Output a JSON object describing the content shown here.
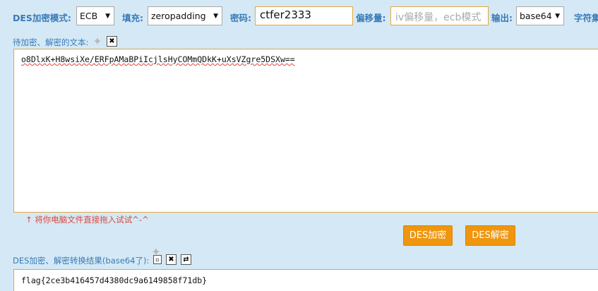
{
  "toolbar": {
    "mode_label": "DES加密模式:",
    "mode_value": "ECB",
    "padding_label": "填充:",
    "padding_value": "zeropadding",
    "password_label": "密码:",
    "password_value": "ctfer2333",
    "iv_label": "偏移量:",
    "iv_placeholder": "iv偏移量，ecb模式",
    "output_label": "输出:",
    "output_value": "base64",
    "charset_label": "字符集"
  },
  "input_section": {
    "label": "待加密、解密的文本:",
    "clear_icon": "✖",
    "value": "o8DlxK+H8wsiXe/ERFpAMaBPiIcjlsHyCOMmQDkK+uXsVZgre5DSXw==",
    "hint": "↑ 将你电脑文件直接拖入试试^-^"
  },
  "actions": {
    "encrypt_label": "DES加密",
    "decrypt_label": "DES解密"
  },
  "result_section": {
    "label": "DES加密、解密转换结果(base64了):",
    "clear_icon": "✖",
    "swap_icon": "⇄",
    "value": "flag{2ce3b416457d4380dc9a6149858f71db}"
  },
  "colors": {
    "background": "#d4e9f5",
    "accent_label": "#3a7ab8",
    "input_border": "#e3a73f",
    "button": "#f0960e",
    "hint": "#e0443a"
  }
}
